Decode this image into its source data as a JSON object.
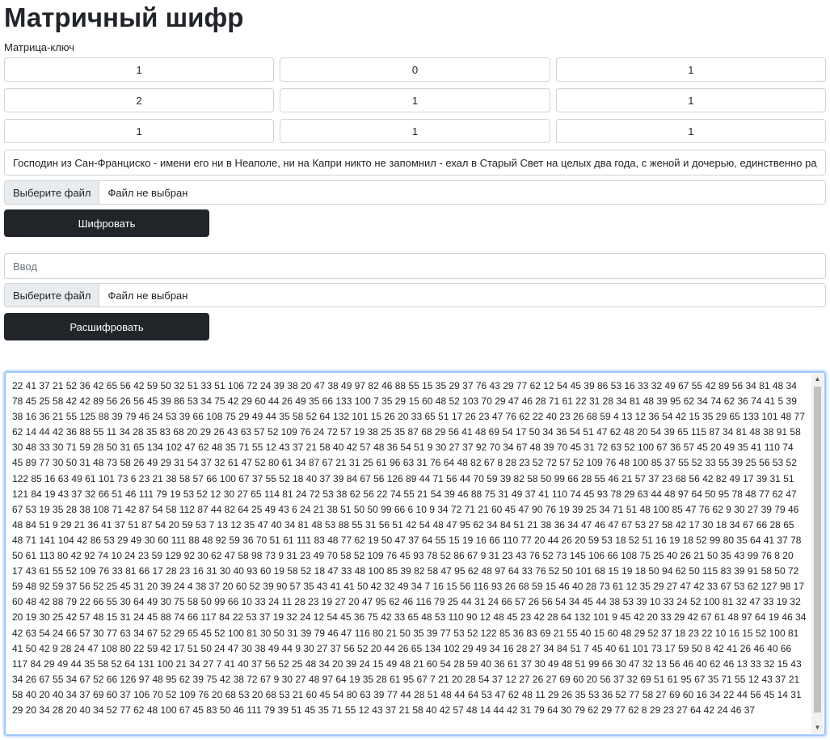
{
  "title": "Матричный шифр",
  "matrix_label": "Матрица-ключ",
  "matrix": [
    [
      "1",
      "0",
      "1"
    ],
    [
      "2",
      "1",
      "1"
    ],
    [
      "1",
      "1",
      "1"
    ]
  ],
  "encrypt": {
    "input_value": "Господин из Сан-Франциско - имени его ни в Неаполе, ни на Капри никто не запомнил - ехал в Старый Свет на целых два года, с женой и дочерью, единственно ради развлечения.",
    "file_button": "Выберите файл",
    "file_status": "Файл не выбран",
    "button_label": "Шифровать"
  },
  "decrypt": {
    "input_placeholder": "Ввод",
    "file_button": "Выберите файл",
    "file_status": "Файл не выбран",
    "button_label": "Расшифровать"
  },
  "output": {
    "text": "22 41 37 21 52 36 42 65 56 42 59 50 32 51 33 51 106 72 24 39 38 20 47 38 49 97 82 46 88 55 15 35 29 37 76 43 29 77 62 12 54 45 39 86 53 16 33 32 49 67 55 42 89 56 34 81 48 34 78 45 25 58 42 42 89 56 26 56 45 39 86 53 34 75 42 29 60 44 26 49 35 66 133 100 7 35 29 15 60 48 52 103 70 29 47 46 28 71 61 22 31 28 34 81 48 39 95 62 34 74 62 36 74 41 5 39 38 16 36 21 55 125 88 39 79 46 24 53 39 66 108 75 29 49 44 35 58 52 64 132 101 15 26 20 33 65 51 17 26 23 47 76 62 22 40 23 26 68 59 4 13 12 36 54 42 15 35 29 65 133 101 48 77 62 14 44 42 36 88 55 11 34 28 35 83 68 20 29 26 43 63 57 52 109 76 24 72 57 19 38 25 35 87 68 29 56 41 48 69 54 17 50 34 36 54 51 47 62 48 20 54 39 65 115 87 34 81 48 38 91 58 30 48 33 30 71 59 28 50 31 65 134 102 47 62 48 35 71 55 12 43 37 21 58 40 42 57 48 36 54 51 9 30 27 37 92 70 34 67 48 39 70 45 31 72 63 52 100 67 36 57 45 20 49 35 41 110 74 45 89 77 30 50 31 48 73 58 26 49 29 31 54 37 32 61 47 52 80 61 34 87 67 21 31 25 61 96 63 31 76 64 48 82 67 8 28 23 52 72 57 52 109 76 48 100 85 37 55 52 33 55 39 25 56 53 52 122 85 16 63 49 61 101 73 6 23 21 38 58 57 66 100 67 37 55 52 18 40 37 39 84 67 56 126 89 44 71 56 44 70 59 39 82 58 50 99 66 28 55 46 21 57 37 23 68 56 42 82 49 17 39 31 51 121 84 19 43 37 32 66 51 46 111 79 19 53 52 12 30 27 65 114 81 24 72 53 38 62 56 22 74 55 21 54 39 46 88 75 31 49 37 41 110 74 45 93 78 29 63 44 48 97 64 50 95 78 48 77 62 47 67 53 19 35 28 38 108 71 42 87 54 58 112 87 44 82 64 25 49 43 6 24 21 38 51 50 50 99 66 6 10 9 34 72 71 21 60 45 47 90 76 19 39 25 34 71 51 48 100 85 47 76 62 9 30 27 39 79 46 48 84 51 9 29 21 36 41 37 51 87 54 20 59 53 7 13 12 35 47 40 34 81 48 53 88 55 31 56 51 42 54 48 47 95 62 34 84 51 21 38 36 34 47 46 47 67 53 27 58 42 17 30 18 34 67 66 28 65 48 71 141 104 42 86 53 29 49 30 60 111 88 48 92 59 36 70 51 61 111 83 48 77 62 19 50 47 37 64 55 15 19 16 66 110 77 20 44 26 20 59 53 18 52 51 16 19 18 52 99 80 35 64 41 37 78 50 61 113 80 42 92 74 10 24 23 59 129 92 30 62 47 58 98 73 9 31 23 49 70 58 52 109 76 45 93 78 52 86 67 9 31 23 43 76 52 73 145 106 66 108 75 25 40 26 21 50 35 43 99 76 8 20 17 43 61 55 52 109 76 33 81 66 17 28 23 16 31 30 40 93 60 19 58 52 18 47 33 48 100 85 39 82 58 47 95 62 48 97 64 33 76 52 50 101 68 15 19 18 50 94 62 50 115 83 39 91 58 50 72 59 48 92 59 37 56 52 25 45 31 20 39 24 4 38 37 20 60 52 39 90 57 35 43 41 41 50 42 32 49 34 7 16 15 56 116 93 26 68 59 15 46 40 28 73 61 12 35 29 27 47 42 33 67 53 62 127 98 17 60 48 42 88 79 22 66 55 30 64 49 30 75 58 50 99 66 10 33 24 11 28 23 19 27 20 47 95 62 46 116 79 25 44 31 24 66 57 26 56 54 34 45 44 38 53 39 10 33 24 52 100 81 32 47 33 19 32 20 19 30 25 42 57 48 15 31 24 45 88 74 66 117 84 22 53 37 19 32 24 12 54 45 36 75 42 33 65 48 53 110 90 12 48 45 23 42 28 64 132 101 9 45 42 20 33 29 42 67 61 48 97 64 19 46 34 42 63 54 24 66 57 30 77 63 34 67 52 29 65 45 52 100 81 30 50 31 39 79 46 47 116 80 21 50 35 39 77 53 52 122 85 36 83 69 21 55 40 15 60 48 29 52 37 18 23 22 10 16 15 52 100 81 41 50 42 9 28 24 47 108 80 22 59 42 17 51 50 24 47 30 38 49 44 9 30 27 37 56 52 20 44 26 65 134 102 29 49 34 16 28 27 34 84 51 7 45 40 61 101 73 17 59 50 8 42 41 26 46 40 66 117 84 29 49 44 35 58 52 64 131 100 21 34 27 7 41 40 37 56 52 25 48 34 20 39 24 15 49 48 21 60 54 28 59 40 36 61 37 30 49 48 51 99 66 30 47 32 13 56 46 40 62 46 13 33 32 15 43 34 26 67 55 34 67 52 66 126 97 48 95 62 39 75 42 38 72 67 9 30 27 48 97 64 19 35 28 61 95 67 7 21 20 28 54 37 12 27 26 27 69 60 20 56 37 32 69 51 61 95 67 35 71 55 12 43 37 21 58 40 20 40 34 37 69 60 37 106 70 52 109 76 20 68 53 20 68 53 21 60 45 54 80 63 39 77 44 28 51 48 44 64 53 47 62 48 11 29 26 35 53 36 52 77 58 27 69 60 16 34 22 44 56 45 14 31 29 20 34 28 20 40 34 52 77 62 48 100 67 45 83 50 46 111 79 39 51 45 35 71 55 12 43 37 21 58 40 42 57 48 14 44 42 31 79 64 30 79 62 29 77 62 8 29 23 27 64 42 24 46 37"
  }
}
